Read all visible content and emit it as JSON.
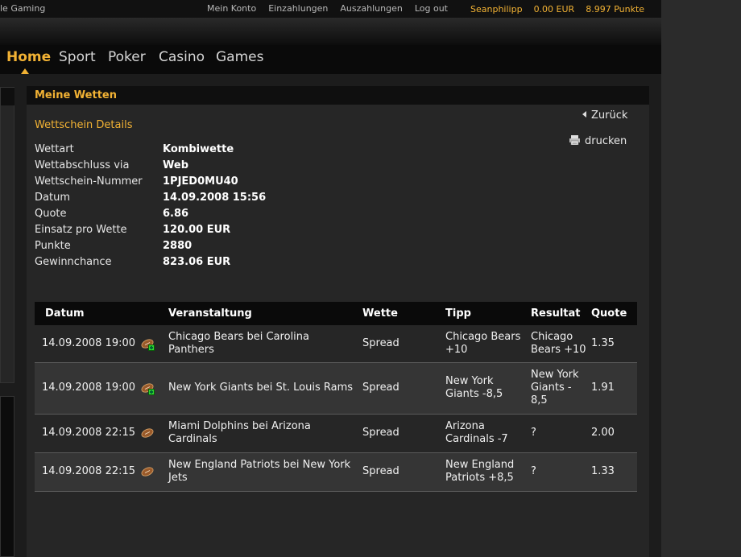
{
  "topbar": {
    "brand": "le Gaming",
    "links": [
      "Mein Konto",
      "Einzahlungen",
      "Auszahlungen",
      "Log out"
    ],
    "user": {
      "name": "Seanphilipp",
      "balance": "0.00 EUR",
      "points": "8.997 Punkte"
    }
  },
  "nav": {
    "items": [
      "Home",
      "Sport",
      "Poker",
      "Casino",
      "Games"
    ],
    "active": "Home"
  },
  "panel": {
    "title": "Meine Wetten",
    "section_title": "Wettschein Details",
    "back_label": "Zurück",
    "print_label": "drucken"
  },
  "details": [
    {
      "k": "Wettart",
      "v": "Kombiwette"
    },
    {
      "k": "Wettabschluss via",
      "v": "Web"
    },
    {
      "k": "Wettschein-Nummer",
      "v": "1PJED0MU40"
    },
    {
      "k": "Datum",
      "v": "14.09.2008 15:56"
    },
    {
      "k": "Quote",
      "v": "6.86"
    },
    {
      "k": "Einsatz pro Wette",
      "v": "120.00 EUR"
    },
    {
      "k": "Punkte",
      "v": "2880"
    },
    {
      "k": "Gewinnchance",
      "v": "823.06 EUR"
    }
  ],
  "table": {
    "headers": [
      "Datum",
      "Veranstaltung",
      "Wette",
      "Tipp",
      "Resultat",
      "Quote"
    ],
    "rows": [
      {
        "datum": "14.09.2008 19:00",
        "event": [
          "Chicago Bears bei Carolina",
          "Panthers"
        ],
        "wette": "Spread",
        "tipp": [
          "Chicago Bears",
          "+10"
        ],
        "resultat": [
          "Chicago",
          "Bears +10"
        ],
        "quote": "1.35",
        "live": true
      },
      {
        "datum": "14.09.2008 19:00",
        "event": [
          "New York Giants bei St. Louis Rams"
        ],
        "wette": "Spread",
        "tipp": [
          "New York",
          "Giants -8,5"
        ],
        "resultat": [
          "New York",
          "Giants -",
          "8,5"
        ],
        "quote": "1.91",
        "live": true
      },
      {
        "datum": "14.09.2008 22:15",
        "event": [
          "Miami Dolphins bei Arizona",
          "Cardinals"
        ],
        "wette": "Spread",
        "tipp": [
          "Arizona",
          "Cardinals -7"
        ],
        "resultat": [
          "?"
        ],
        "quote": "2.00",
        "live": false
      },
      {
        "datum": "14.09.2008 22:15",
        "event": [
          "New England Patriots bei New York",
          "Jets"
        ],
        "wette": "Spread",
        "tipp": [
          "New England",
          "Patriots +8,5"
        ],
        "resultat": [
          "?"
        ],
        "quote": "1.33",
        "live": false
      }
    ]
  },
  "colors": {
    "accent": "#f2b234",
    "background": "#1c1c1c",
    "panel": "#262626",
    "header": "#0a0a0a"
  }
}
